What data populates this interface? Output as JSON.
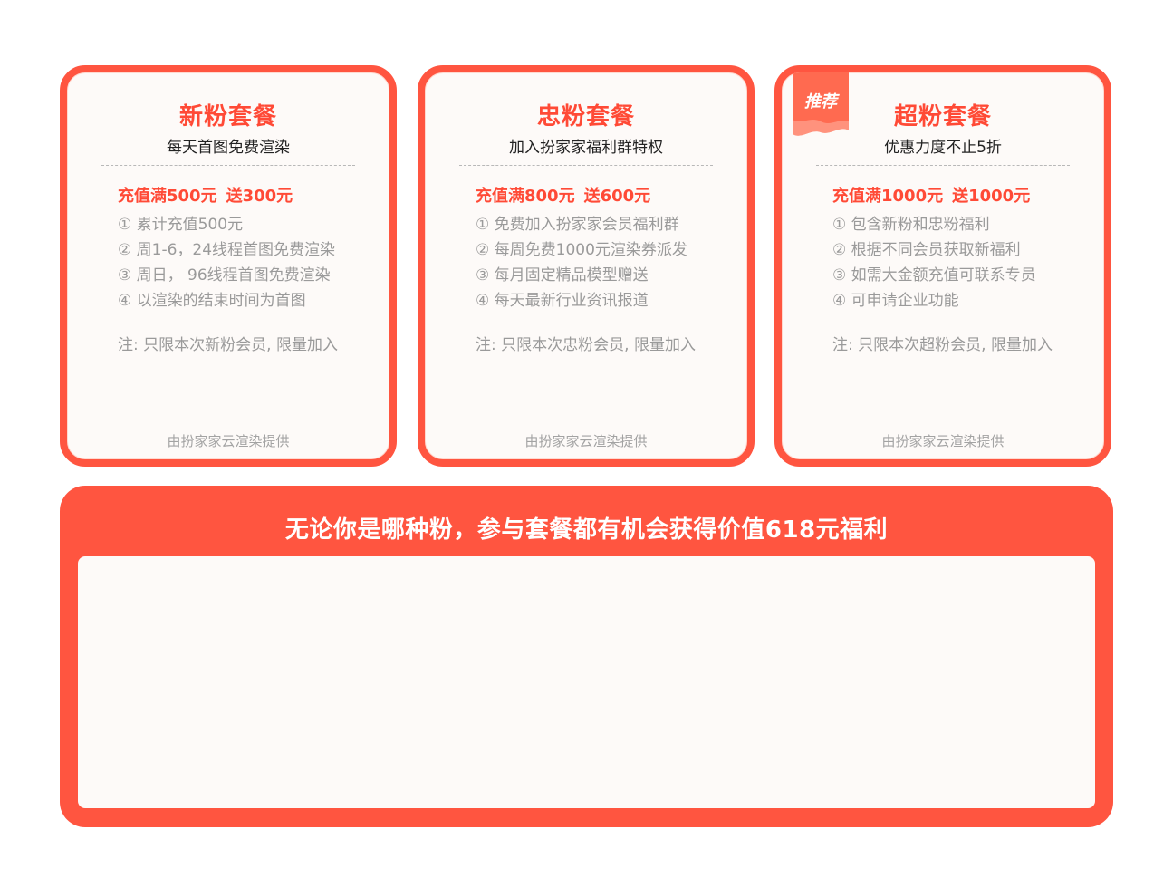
{
  "cards": [
    {
      "title": "新粉套餐",
      "subtitle": "每天首图免费渲染",
      "offer": {
        "recharge": "充值满500元",
        "gift": "送300元"
      },
      "features": [
        "①  累计充值500元",
        "② 周1-6，24线程首图免费渲染",
        "③ 周日， 96线程首图免费渲染",
        "④ 以渲染的结束时间为首图"
      ],
      "note": "注: 只限本次新粉会员, 限量加入",
      "footer": "由扮家家云渲染提供"
    },
    {
      "title": "忠粉套餐",
      "subtitle": "加入扮家家福利群特权",
      "offer": {
        "recharge": "充值满800元",
        "gift": "送600元"
      },
      "features": [
        "① 免费加入扮家家会员福利群",
        "② 每周免费1000元渲染券派发",
        "③ 每月固定精品模型赠送",
        "④ 每天最新行业资讯报道"
      ],
      "note": "注: 只限本次忠粉会员, 限量加入",
      "footer": "由扮家家云渲染提供"
    },
    {
      "title": "超粉套餐",
      "subtitle": "优惠力度不止5折",
      "badge": "推荐",
      "offer": {
        "recharge": "充值满1000元",
        "gift": "送1000元"
      },
      "features": [
        "① 包含新粉和忠粉福利",
        "② 根据不同会员获取新福利",
        "③ 如需大金额充值可联系专员",
        "④ 可申请企业功能"
      ],
      "note": "注: 只限本次超粉会员, 限量加入",
      "footer": "由扮家家云渲染提供"
    }
  ],
  "benefit": {
    "title": "无论你是哪种粉，参与套餐都有机会获得价值618元福利"
  },
  "colors": {
    "accent": "#ff5540",
    "accent_text": "#ff4a36",
    "card_bg": "#fdfaf8",
    "muted_text": "#9a9a9a",
    "badge_bg": "#ff6a50"
  },
  "icons": {
    "badge": "ribbon-badge-icon"
  }
}
